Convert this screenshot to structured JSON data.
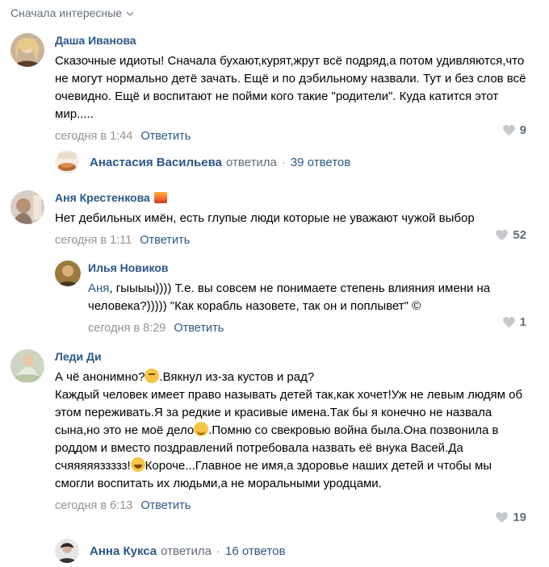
{
  "sort": {
    "label": "Сначала интересные"
  },
  "comments": [
    {
      "author": "Даша Иванова",
      "text": "Сказочные идиоты! Сначала бухают,курят,жрут всё подряд,а потом удивляются,что не могут нормально детё зачать. Ещё и по дэбильному назвали. Тут и без слов всё очевидно. Ещё и воспитают не пойми кого такие \"родители\". Куда катится этот мир.....",
      "time": "сегодня в 1:44",
      "reply_label": "Ответить",
      "likes": "9"
    },
    {
      "author": "Аня Крестенкова",
      "text": "Нет дебильных имён, есть глупые люди которые не уважают чужой выбор",
      "time": "сегодня в 1:11",
      "reply_label": "Ответить",
      "likes": "52"
    },
    {
      "author": "Леди Ди",
      "text_parts": [
        "А чё анонимно?",
        ".Вякнул из-за кустов и рад?\nКаждый человек имеет право называть детей так,как хочет!Уж не левым людям об этом переживать.Я за редкие и красивые имена.Так бы я конечно не назвала сына,но это не моё дело",
        ".Помню со свекровью война была.Она позвонила в роддом и вместо поздравлений потребовала назвать её внука Васей.Да счяяяяяззззз!",
        "Короче...Главное не имя,а здоровье наших детей и чтобы мы смогли воспитать их людьми,а не моральными уродцами."
      ],
      "time": "сегодня в 6:13",
      "reply_label": "Ответить",
      "likes": "19"
    }
  ],
  "threads": [
    {
      "author": "Анастасия Васильева",
      "verb": "ответила",
      "count": "39 ответов"
    },
    {
      "author": "Анна Кукса",
      "verb": "ответила",
      "count": "16 ответов"
    }
  ],
  "reply": {
    "author": "Илья Новиков",
    "mention": "Аня",
    "text": ", гыыыы)))) Т.е. вы совсем не понимаете степень влияния имени на человека?))))) \"Как корабль назовете, так он и поплывет\" ©",
    "time": "сегодня в 8:29",
    "reply_label": "Ответить",
    "likes": "1"
  },
  "icons": {
    "like": "heart-icon",
    "sort": "chevron-down-icon"
  },
  "colors": {
    "link": "#2a5885",
    "meta": "#939393",
    "heart": "#c4c8cc"
  }
}
